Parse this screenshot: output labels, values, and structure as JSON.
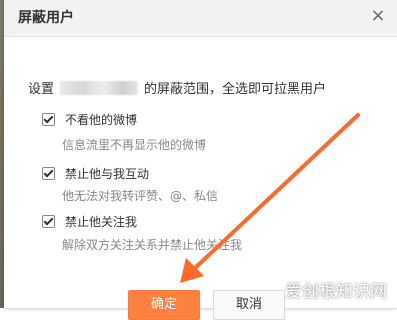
{
  "dialog": {
    "title": "屏蔽用户",
    "close_icon": "×",
    "description_prefix": "设置",
    "description_suffix": "的屏蔽范围，全选即可拉黑用户",
    "options": [
      {
        "label": "不看他的微博",
        "sub": "信息流里不再显示他的微博",
        "checked": true
      },
      {
        "label": "禁止他与我互动",
        "sub": "他无法对我转评赞、@、私信",
        "checked": true
      },
      {
        "label": "禁止他关注我",
        "sub": "解除双方关注关系并禁止他关注我",
        "checked": true
      }
    ],
    "confirm_label": "确定",
    "cancel_label": "取消"
  },
  "watermark": "爱创根知识网",
  "colors": {
    "confirm_bg": "#ff8140",
    "arrow": "#ff6a2a",
    "header_bg": "#f2f2f2"
  }
}
